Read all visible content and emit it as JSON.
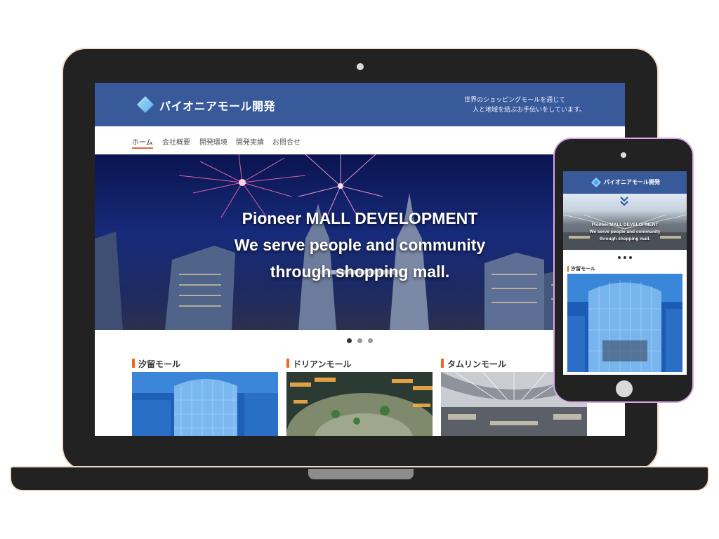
{
  "brand": {
    "name": "パイオニアモール開発",
    "tagline_line1": "世界のショッピングモールを通じて",
    "tagline_line2": "人と地域を結ぶお手伝いをしています。",
    "color_primary": "#38599a",
    "color_accent": "#ec6a1c"
  },
  "nav": {
    "items": [
      {
        "label": "ホーム",
        "active": true
      },
      {
        "label": "会社概要",
        "active": false
      },
      {
        "label": "開発環境",
        "active": false
      },
      {
        "label": "開発実績",
        "active": false
      },
      {
        "label": "お問合せ",
        "active": false
      }
    ]
  },
  "hero": {
    "line1": "Pioneer MALL DEVELOPMENT",
    "line2": "We serve people and community",
    "line3": "through shopping mall.",
    "slide_count": 3,
    "active_slide": 1
  },
  "malls": [
    {
      "title": "汐留モール",
      "image": "glass-building-photo"
    },
    {
      "title": "ドリアンモール",
      "image": "mall-plaza-photo"
    },
    {
      "title": "タムリンモール",
      "image": "mall-interior-photo"
    }
  ],
  "mobile": {
    "brand_name": "パイオニアモール開発",
    "banner_line1": "Pioneer MALL DEVELOPMENT",
    "banner_line2": "We serve people and community",
    "banner_line3": "through shopping mall.",
    "menu_icon": "double-chevron-down-icon",
    "card_title": "汐留モール"
  }
}
